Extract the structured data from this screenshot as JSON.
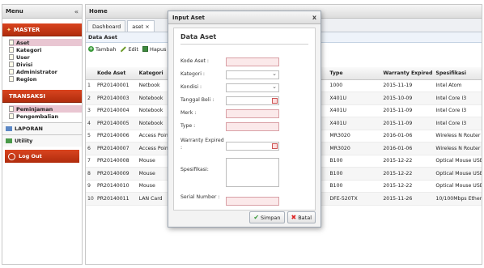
{
  "sidebar": {
    "title": "Menu",
    "collapse_icon": "«",
    "master": {
      "label": "MASTER",
      "items": [
        "Aset",
        "Kategori",
        "User",
        "Divisi",
        "Administrator",
        "Region"
      ]
    },
    "transaksi": {
      "label": "TRANSAKSI",
      "items": [
        "Peminjaman",
        "Pengembalian"
      ]
    },
    "laporan": "LAPORAN",
    "utility": "Utility",
    "logout": "Log Out"
  },
  "main": {
    "title": "Home",
    "tabs": [
      {
        "label": "Dashboard",
        "active": false
      },
      {
        "label": "aset ×",
        "active": true
      }
    ],
    "panel_title": "Data Aset",
    "toolbar": {
      "add": "Tambah",
      "edit": "Edit",
      "delete": "Hapus"
    },
    "columns": [
      "Kode Aset",
      "Kategori",
      "Type",
      "Warranty Expired",
      "Spesifikasi"
    ],
    "rows": [
      {
        "no": "1",
        "kode": "PR20140001",
        "kategori": "Netbook",
        "type": "1000",
        "warranty": "2015-11-19",
        "spek": "Intel Atom"
      },
      {
        "no": "2",
        "kode": "PR20140003",
        "kategori": "Notebook",
        "type": "X401U",
        "warranty": "2015-10-09",
        "spek": "Intel Core I3"
      },
      {
        "no": "3",
        "kode": "PR20140004",
        "kategori": "Notebook",
        "type": "X401U",
        "warranty": "2015-11-09",
        "spek": "Intel Core I3"
      },
      {
        "no": "4",
        "kode": "PR20140005",
        "kategori": "Notebook",
        "type": "X401U",
        "warranty": "2015-11-09",
        "spek": "Intel Core I3"
      },
      {
        "no": "5",
        "kode": "PR20140006",
        "kategori": "Access Point",
        "type": "MR3020",
        "warranty": "2016-01-06",
        "spek": "Wireless N Router"
      },
      {
        "no": "6",
        "kode": "PR20140007",
        "kategori": "Access Point",
        "type": "MR3020",
        "warranty": "2016-01-06",
        "spek": "Wireless N Router"
      },
      {
        "no": "7",
        "kode": "PR20140008",
        "kategori": "Mouse",
        "type": "B100",
        "warranty": "2015-12-22",
        "spek": "Optical Mouse USB"
      },
      {
        "no": "8",
        "kode": "PR20140009",
        "kategori": "Mouse",
        "type": "B100",
        "warranty": "2015-12-22",
        "spek": "Optical Mouse USB"
      },
      {
        "no": "9",
        "kode": "PR20140010",
        "kategori": "Mouse",
        "type": "B100",
        "warranty": "2015-12-22",
        "spek": "Optical Mouse USB"
      },
      {
        "no": "10",
        "kode": "PR20140011",
        "kategori": "LAN Card",
        "type": "DFE-520TX",
        "warranty": "2015-11-26",
        "spek": "10/100Mbps Ether"
      }
    ]
  },
  "modal": {
    "title": "Input Aset",
    "close": "x",
    "section": "Data Aset",
    "fields": {
      "kode": "Kode Aset :",
      "kategori": "Kategori :",
      "kondisi": "Kondisi :",
      "tanggal": "Tanggal Beli :",
      "merk": "Merk :",
      "type": "Type :",
      "warranty": "Warranty Expired :",
      "spek": "Spesifikasi:",
      "serial": "Serial Number :"
    },
    "save": "Simpan",
    "cancel": "Batal"
  }
}
